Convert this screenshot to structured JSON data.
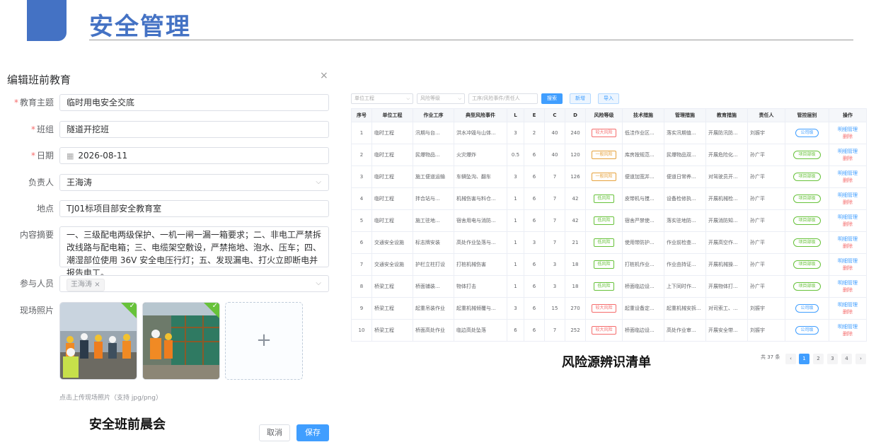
{
  "header": {
    "title": "安全管理"
  },
  "dialog": {
    "title": "编辑班前教育",
    "close": "×",
    "fields": {
      "topic": {
        "label": "教育主题",
        "value": "临时用电安全交底"
      },
      "team": {
        "label": "班组",
        "value": "隧道开挖班"
      },
      "date": {
        "label": "日期",
        "value": "2026-08-11"
      },
      "leader": {
        "label": "负责人",
        "value": "王海涛"
      },
      "location": {
        "label": "地点",
        "value": "TJ01标项目部安全教育室"
      },
      "summary": {
        "label": "内容摘要",
        "value": "一、三级配电两级保护、一机一闸一漏一箱要求；二、非电工严禁拆改线路与配电箱；三、电缆架空敷设，严禁拖地、泡水、压车；四、潮湿部位使用 36V 安全电压行灯；五、发现漏电、打火立即断电并报告电工。"
      },
      "participants": {
        "label": "参与人员",
        "tag": "王海涛",
        "tag_close": "×"
      },
      "photos": {
        "label": "现场照片"
      }
    },
    "upload_plus": "+",
    "hint": "点击上传现场照片（支持 jpg/png）",
    "cancel": "取消",
    "save": "保存",
    "caption": "安全班前晨会"
  },
  "risk": {
    "filters": {
      "unit": "单位工程",
      "level": "风险等级",
      "search": "工序/风险事件/责任人"
    },
    "buttons": {
      "search": "搜索",
      "add": "新增",
      "import": "导入"
    },
    "columns": [
      "序号",
      "单位工程",
      "作业工序",
      "典型风险事件",
      "L",
      "E",
      "C",
      "D",
      "风险等级",
      "技术措施",
      "管理措施",
      "教育措施",
      "责任人",
      "管控层别",
      "操作"
    ],
    "rows": [
      [
        "1",
        "临时工程",
        "汛期与台...",
        "洪水冲毁与山体...",
        "3",
        "2",
        "40",
        "240",
        "较大风险",
        "低洼作业区...",
        "落实汛期值...",
        "开展防汛防...",
        "刘振宇",
        "公司级"
      ],
      [
        "2",
        "临时工程",
        "民爆物品...",
        "火灾爆炸",
        "0.5",
        "6",
        "40",
        "120",
        "一般风险",
        "库房按规范...",
        "民爆物品双...",
        "开展危险化...",
        "孙广平",
        "项目部级"
      ],
      [
        "3",
        "临时工程",
        "施工便道运输",
        "车辆坠沟、翻车",
        "3",
        "6",
        "7",
        "126",
        "一般风险",
        "便道加宽并...",
        "便道日常养...",
        "对驾驶员开...",
        "孙广平",
        "项目部级"
      ],
      [
        "4",
        "临时工程",
        "拌合站与...",
        "机械伤害与料仓...",
        "1",
        "6",
        "7",
        "42",
        "低风险",
        "皮带机与搅...",
        "设备检修执...",
        "开展机械检...",
        "孙广平",
        "项目部级"
      ],
      [
        "5",
        "临时工程",
        "施工驻地...",
        "宿舍用电与消防...",
        "1",
        "6",
        "7",
        "42",
        "低风险",
        "宿舍严禁使...",
        "落实驻地防...",
        "开展消防知...",
        "孙广平",
        "项目部级"
      ],
      [
        "6",
        "交通安全设施",
        "标志牌安装",
        "高处作业坠落与...",
        "1",
        "3",
        "7",
        "21",
        "低风险",
        "使用带防护...",
        "作业前检查...",
        "开展高空作...",
        "孙广平",
        "项目部级"
      ],
      [
        "7",
        "交通安全设施",
        "护栏立柱打设",
        "打桩机械伤害",
        "1",
        "6",
        "3",
        "18",
        "低风险",
        "打桩机作业...",
        "作业由持证...",
        "开展机械操...",
        "孙广平",
        "项目部级"
      ],
      [
        "8",
        "桥梁工程",
        "桥面铺装...",
        "物体打击",
        "1",
        "6",
        "3",
        "18",
        "低风险",
        "桥面临边设...",
        "上下同时作...",
        "开展物体打...",
        "孙广平",
        "项目部级"
      ],
      [
        "9",
        "桥梁工程",
        "起重吊装作业",
        "起重机械倾覆与...",
        "3",
        "6",
        "15",
        "270",
        "较大风险",
        "起重设备定...",
        "起重机械安拆...",
        "对司索工、...",
        "刘振宇",
        "公司级"
      ],
      [
        "10",
        "桥梁工程",
        "桥面高处作业",
        "临边高处坠落",
        "6",
        "6",
        "7",
        "252",
        "较大风险",
        "桥面临边设...",
        "高处作业审...",
        "开展安全带...",
        "刘振宇",
        "公司级"
      ]
    ],
    "op_view": "明细管理",
    "op_delete": "删除",
    "pager": {
      "total": "共 37 条",
      "prev": "‹",
      "next": "›",
      "pages": [
        "1",
        "2",
        "3",
        "4"
      ]
    },
    "caption": "风险源辨识清单"
  },
  "colors": {
    "brand": "#4472c4",
    "primary": "#409eff",
    "danger": "#f56c6c",
    "warning": "#e6a23c",
    "success": "#67c23a"
  }
}
